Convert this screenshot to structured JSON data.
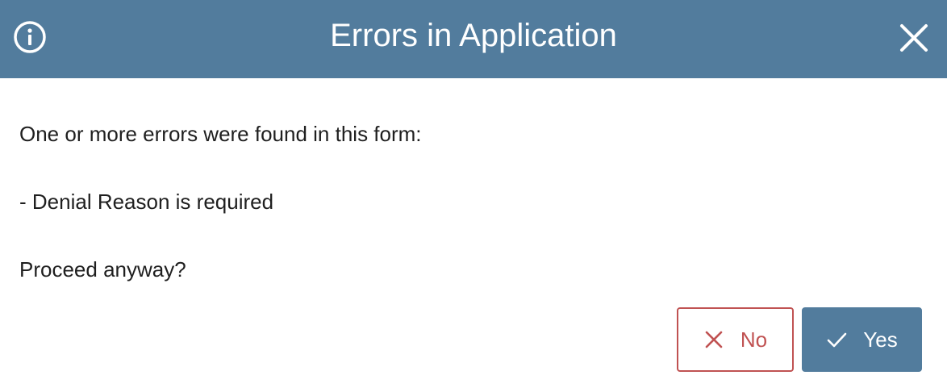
{
  "dialog": {
    "title": "Errors in Application",
    "header_icon": "info-icon",
    "close_icon": "close-icon",
    "message_intro": "One or more errors were found in this form:",
    "errors": [
      "- Denial Reason is required"
    ],
    "prompt": "Proceed anyway?",
    "buttons": {
      "no_label": "No",
      "no_icon": "x-icon",
      "yes_label": "Yes",
      "yes_icon": "check-icon"
    }
  },
  "colors": {
    "header_bg": "#527c9d",
    "accent": "#527c9d",
    "danger": "#c05252",
    "text": "#1f1f1f"
  }
}
